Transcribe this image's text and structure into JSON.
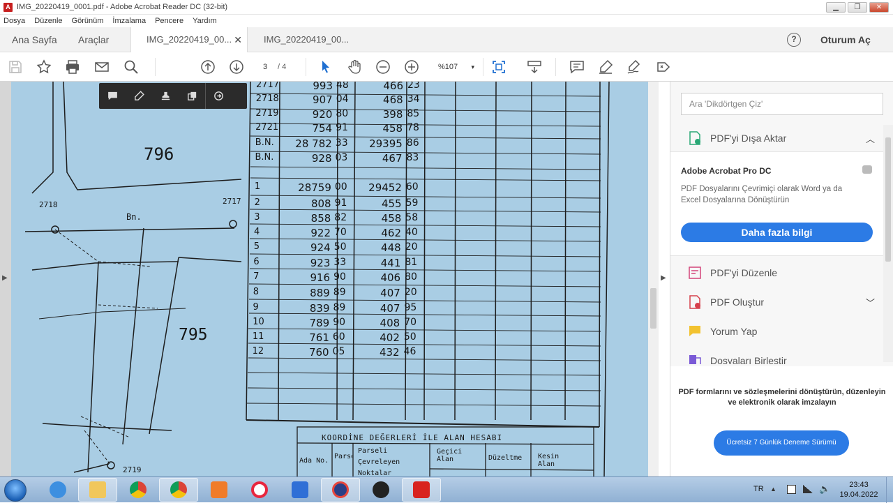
{
  "window": {
    "title": "IMG_20220419_0001.pdf - Adobe Acrobat Reader DC (32-bit)",
    "controls": [
      "minimize",
      "maximize",
      "close"
    ]
  },
  "menu": [
    "Dosya",
    "Düzenle",
    "Görünüm",
    "İmzalama",
    "Pencere",
    "Yardım"
  ],
  "nav_tabs": {
    "home": "Ana Sayfa",
    "tools": "Araçlar"
  },
  "doc_tabs": [
    {
      "label": "IMG_20220419_00...",
      "active": true
    },
    {
      "label": "IMG_20220419_00...",
      "active": false
    }
  ],
  "help_label": "?",
  "sign_in": "Oturum Aç",
  "toolbar": {
    "current_page": "3",
    "page_separator": "/ 4",
    "zoom": "%107"
  },
  "document": {
    "parcel_labels": {
      "top": "796",
      "bottom": "795"
    },
    "point_labels": {
      "p2718": "2718",
      "p2717": "2717",
      "p2719": "2719",
      "bn": "Bn."
    },
    "table_rows": [
      {
        "no": "2717",
        "a": "993",
        "b": "48",
        "c": "466",
        "d": "23"
      },
      {
        "no": "2718",
        "a": "907",
        "b": "04",
        "c": "468",
        "d": "34"
      },
      {
        "no": "2719",
        "a": "920",
        "b": "80",
        "c": "398",
        "d": "85"
      },
      {
        "no": "2721",
        "a": "754",
        "b": "91",
        "c": "458",
        "d": "78"
      },
      {
        "no": "B.N.",
        "a": "28 782",
        "b": "33",
        "c": "29395",
        "d": "86"
      },
      {
        "no": "B.N.",
        "a": "928",
        "b": "03",
        "c": "467",
        "d": "83"
      },
      {
        "no": "",
        "a": "",
        "b": "",
        "c": "",
        "d": ""
      },
      {
        "no": "1",
        "a": "28759",
        "b": "00",
        "c": "29452",
        "d": "60"
      },
      {
        "no": "2",
        "a": "808",
        "b": "91",
        "c": "455",
        "d": "59"
      },
      {
        "no": "3",
        "a": "858",
        "b": "82",
        "c": "458",
        "d": "58"
      },
      {
        "no": "4",
        "a": "922",
        "b": "70",
        "c": "462",
        "d": "40"
      },
      {
        "no": "5",
        "a": "924",
        "b": "50",
        "c": "448",
        "d": "20"
      },
      {
        "no": "6",
        "a": "923",
        "b": "33",
        "c": "441",
        "d": "81"
      },
      {
        "no": "7",
        "a": "916",
        "b": "90",
        "c": "406",
        "d": "80"
      },
      {
        "no": "8",
        "a": "889",
        "b": "89",
        "c": "407",
        "d": "20"
      },
      {
        "no": "9",
        "a": "839",
        "b": "89",
        "c": "407",
        "d": "95"
      },
      {
        "no": "10",
        "a": "789",
        "b": "90",
        "c": "408",
        "d": "70"
      },
      {
        "no": "11",
        "a": "761",
        "b": "60",
        "c": "402",
        "d": "50"
      },
      {
        "no": "12",
        "a": "760",
        "b": "05",
        "c": "432",
        "d": "46"
      }
    ],
    "bottom_table": {
      "title": "KOORDİNE  DEĞERLERİ  İLE  ALAN  HESABI",
      "col_ada": "Ada No.",
      "col_parsel": "Parsel",
      "col_cevre": "Parseli Çevreleyen Noktalar",
      "col_gecici": "Geçici Alan",
      "col_duzeltme": "Düzeltme",
      "col_kesin": "Kesin Alan"
    }
  },
  "right_panel": {
    "search_placeholder": "Ara 'Dikdörtgen Çiz'",
    "export_label": "PDF'yi Dışa Aktar",
    "promo_title": "Adobe Acrobat Pro DC",
    "promo_desc": "PDF Dosyalarını Çevrimiçi olarak Word ya da Excel Dosyalarına Dönüştürün",
    "promo_button": "Daha fazla bilgi",
    "tools": [
      "PDF'yi Düzenle",
      "PDF Oluştur",
      "Yorum Yap",
      "Dosyaları Birleştir"
    ],
    "bottom_text": "PDF formlarını ve sözleşmelerini dönüştürün, düzenleyin ve elektronik olarak imzalayın",
    "trial_button": "Ücretsiz 7 Günlük Deneme Sürümü"
  },
  "taskbar": {
    "lang": "TR",
    "time": "23:43",
    "date": "19.04.2022"
  },
  "colors": {
    "accent_blue": "#2c7be5",
    "scan_background": "#a9cde4",
    "adobe_red": "#c71f1f"
  }
}
